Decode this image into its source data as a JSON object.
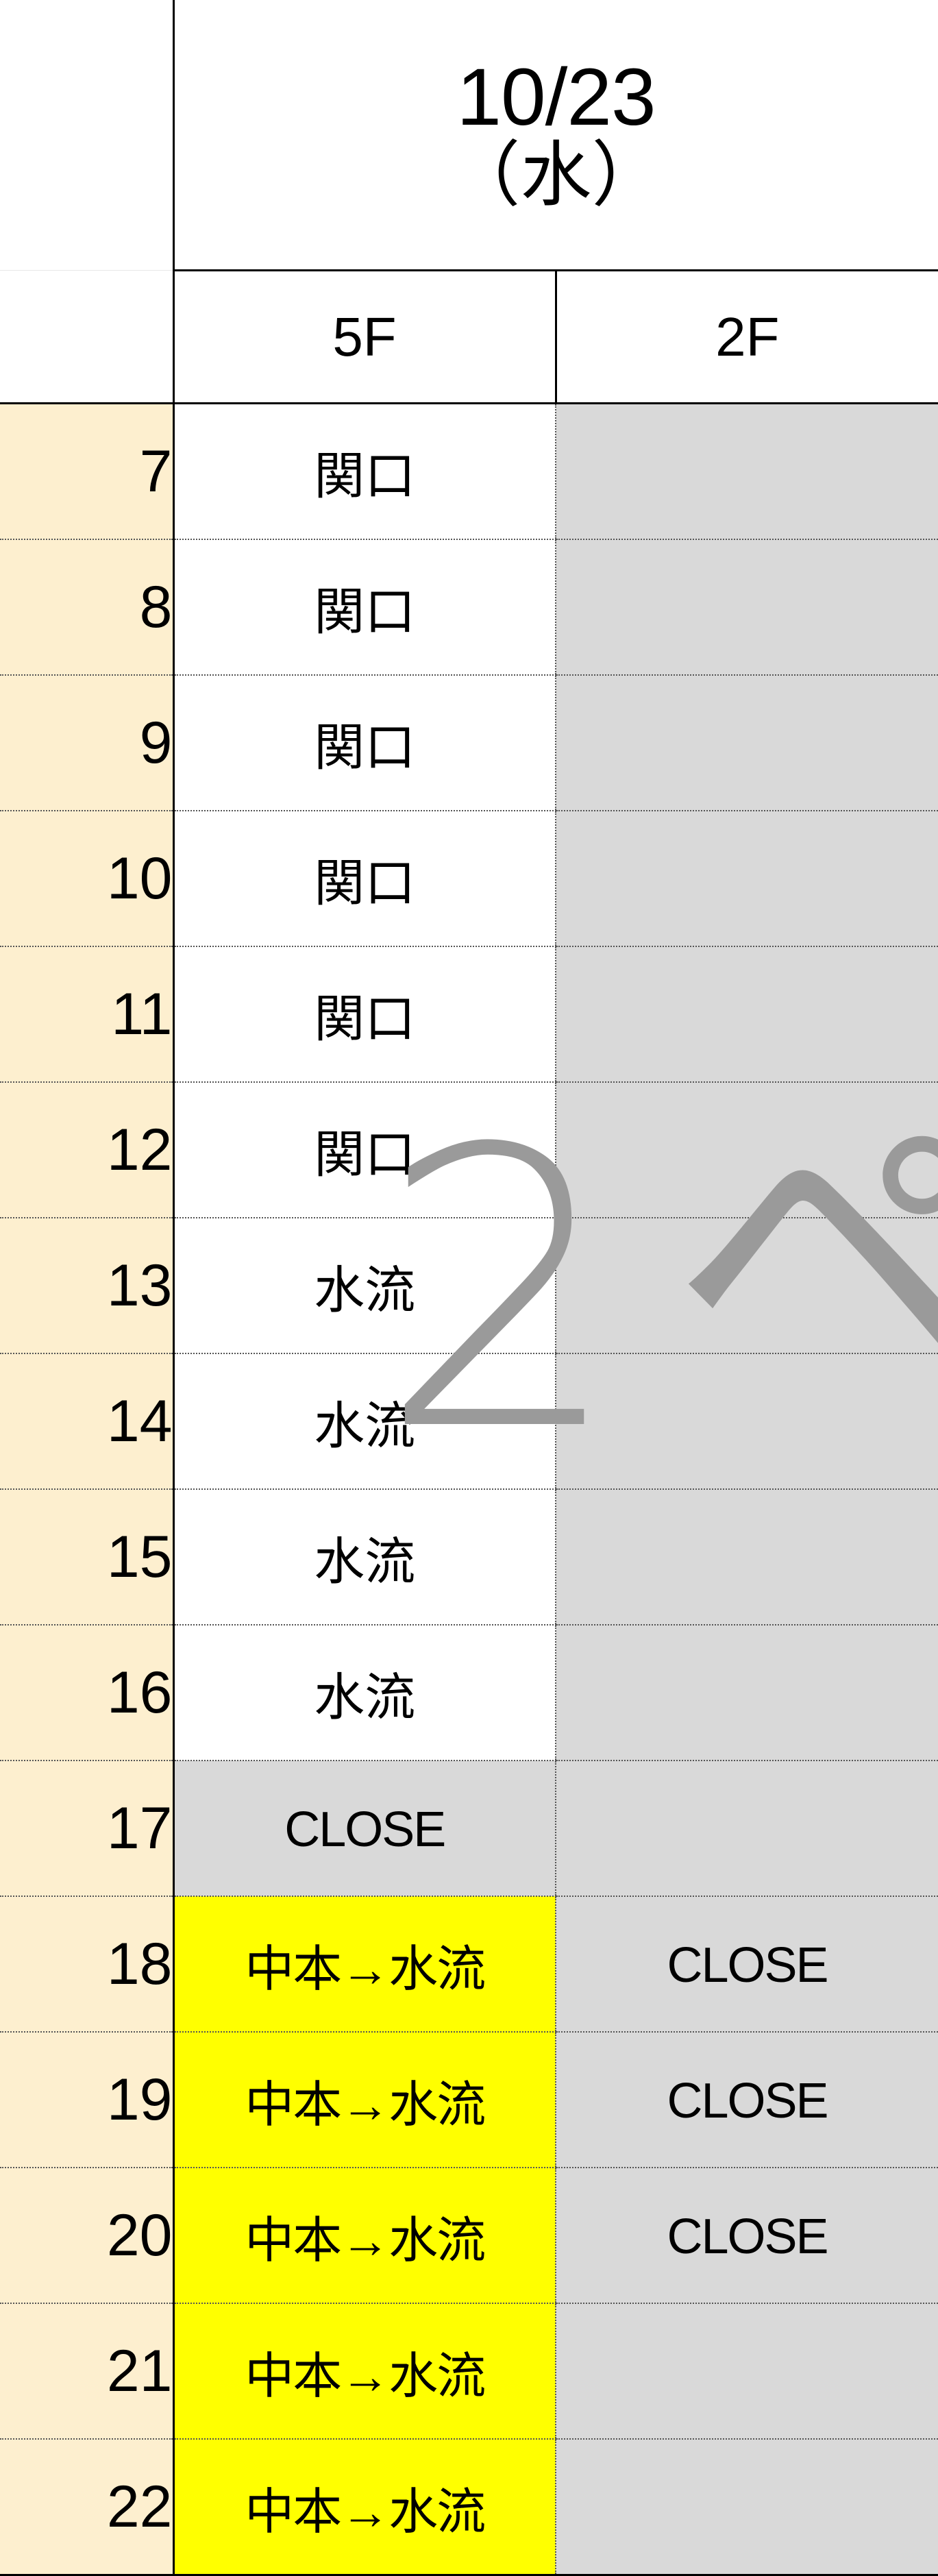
{
  "header": {
    "date": "10/23",
    "weekday": "（水）",
    "corner_label": "",
    "columns": [
      {
        "label": "5F"
      },
      {
        "label": "2F"
      }
    ]
  },
  "watermark": {
    "glyphs": [
      "2",
      "ペ"
    ],
    "color": "#9a9a9a"
  },
  "colors": {
    "hour_column": "#fdefcf",
    "closed": "#d9d9d9",
    "highlight": "#ffff00",
    "open": "#ffffff",
    "grid_line": "#555555",
    "border": "#000000"
  },
  "rows": [
    {
      "hour": "7",
      "f5": {
        "text": "関口",
        "bg": "white"
      },
      "f2": {
        "text": "",
        "bg": "grey"
      }
    },
    {
      "hour": "8",
      "f5": {
        "text": "関口",
        "bg": "white"
      },
      "f2": {
        "text": "",
        "bg": "grey"
      }
    },
    {
      "hour": "9",
      "f5": {
        "text": "関口",
        "bg": "white"
      },
      "f2": {
        "text": "",
        "bg": "grey"
      }
    },
    {
      "hour": "10",
      "f5": {
        "text": "関口",
        "bg": "white"
      },
      "f2": {
        "text": "",
        "bg": "grey"
      }
    },
    {
      "hour": "11",
      "f5": {
        "text": "関口",
        "bg": "white"
      },
      "f2": {
        "text": "",
        "bg": "grey"
      }
    },
    {
      "hour": "12",
      "f5": {
        "text": "関口",
        "bg": "white"
      },
      "f2": {
        "text": "",
        "bg": "grey"
      }
    },
    {
      "hour": "13",
      "f5": {
        "text": "水流",
        "bg": "white"
      },
      "f2": {
        "text": "",
        "bg": "grey"
      }
    },
    {
      "hour": "14",
      "f5": {
        "text": "水流",
        "bg": "white"
      },
      "f2": {
        "text": "",
        "bg": "grey"
      }
    },
    {
      "hour": "15",
      "f5": {
        "text": "水流",
        "bg": "white"
      },
      "f2": {
        "text": "",
        "bg": "grey"
      }
    },
    {
      "hour": "16",
      "f5": {
        "text": "水流",
        "bg": "white"
      },
      "f2": {
        "text": "",
        "bg": "grey"
      }
    },
    {
      "hour": "17",
      "f5": {
        "text": "CLOSE",
        "bg": "grey"
      },
      "f2": {
        "text": "",
        "bg": "grey"
      }
    },
    {
      "hour": "18",
      "f5": {
        "text": "中本→水流",
        "bg": "yellow"
      },
      "f2": {
        "text": "CLOSE",
        "bg": "grey"
      }
    },
    {
      "hour": "19",
      "f5": {
        "text": "中本→水流",
        "bg": "yellow"
      },
      "f2": {
        "text": "CLOSE",
        "bg": "grey"
      }
    },
    {
      "hour": "20",
      "f5": {
        "text": "中本→水流",
        "bg": "yellow"
      },
      "f2": {
        "text": "CLOSE",
        "bg": "grey"
      }
    },
    {
      "hour": "21",
      "f5": {
        "text": "中本→水流",
        "bg": "yellow"
      },
      "f2": {
        "text": "",
        "bg": "grey"
      }
    },
    {
      "hour": "22",
      "f5": {
        "text": "中本→水流",
        "bg": "yellow"
      },
      "f2": {
        "text": "",
        "bg": "grey"
      }
    }
  ]
}
